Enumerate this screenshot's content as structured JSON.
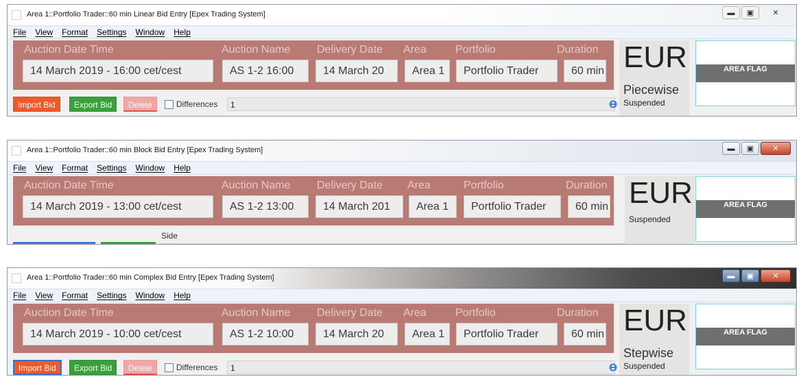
{
  "windows": [
    {
      "title": "Area 1::Portfolio Trader::60 min Linear Bid Entry [Epex Trading System]",
      "menu": [
        "File",
        "View",
        "Format",
        "Settings",
        "Window",
        "Help"
      ],
      "header": {
        "labels": {
          "auction_date_time": "Auction Date Time",
          "auction_name": "Auction Name",
          "delivery_date": "Delivery Date",
          "area": "Area",
          "portfolio": "Portfolio",
          "duration": "Duration"
        },
        "values": {
          "auction_date_time": "14 March 2019 - 16:00 cet/cest",
          "auction_name": "AS 1-2 16:00",
          "delivery_date": "14 March 20",
          "area": "Area 1",
          "portfolio": "Portfolio Trader",
          "duration": "60 min"
        }
      },
      "currency": "EUR",
      "mode": "Piecewise",
      "status": "Suspended",
      "area_flag": "AREA FLAG",
      "toolbar": {
        "import_label": "Import Bid",
        "export_label": "Export Bid",
        "delete_label": "Delete",
        "differences_label": "Differences",
        "differences_value": "1"
      }
    },
    {
      "title": "Area 1::Portfolio Trader::60 min Block Bid Entry [Epex Trading System]",
      "menu": [
        "File",
        "View",
        "Format",
        "Settings",
        "Window",
        "Help"
      ],
      "header": {
        "labels": {
          "auction_date_time": "Auction Date Time",
          "auction_name": "Auction Name",
          "delivery_date": "Delivery Date",
          "area": "Area",
          "portfolio": "Portfolio",
          "duration": "Duration"
        },
        "values": {
          "auction_date_time": "14 March 2019 - 13:00 cet/cest",
          "auction_name": "AS 1-2 13:00",
          "delivery_date": "14 March 201",
          "area": "Area 1",
          "portfolio": "Portfolio Trader",
          "duration": "60 min"
        }
      },
      "currency": "EUR",
      "status": "Suspended",
      "area_flag": "AREA FLAG",
      "side_label": "Side"
    },
    {
      "title": "Area 1::Portfolio Trader::60 min Complex Bid Entry [Epex Trading System]",
      "menu": [
        "File",
        "View",
        "Format",
        "Settings",
        "Window",
        "Help"
      ],
      "header": {
        "labels": {
          "auction_date_time": "Auction Date Time",
          "auction_name": "Auction Name",
          "delivery_date": "Delivery Date",
          "area": "Area",
          "portfolio": "Portfolio",
          "duration": "Duration"
        },
        "values": {
          "auction_date_time": "14 March 2019 - 10:00 cet/cest",
          "auction_name": "AS 1-2 10:00",
          "delivery_date": "14 March 20",
          "area": "Area 1",
          "portfolio": "Portfolio Trader",
          "duration": "60 min"
        }
      },
      "currency": "EUR",
      "mode": "Stepwise",
      "status": "Suspended",
      "area_flag": "AREA FLAG",
      "toolbar": {
        "import_label": "Import Bid",
        "export_label": "Export Bid",
        "delete_label": "Delete",
        "differences_label": "Differences",
        "differences_value": "1"
      }
    }
  ],
  "colors": {
    "header_bg": "#b87a72",
    "import_btn": "#f05a2a",
    "export_btn": "#3aa03a",
    "delete_btn": "#f2a7a7",
    "flag_bar": "#6f6f6f",
    "flag_border": "#7dd3dd"
  }
}
